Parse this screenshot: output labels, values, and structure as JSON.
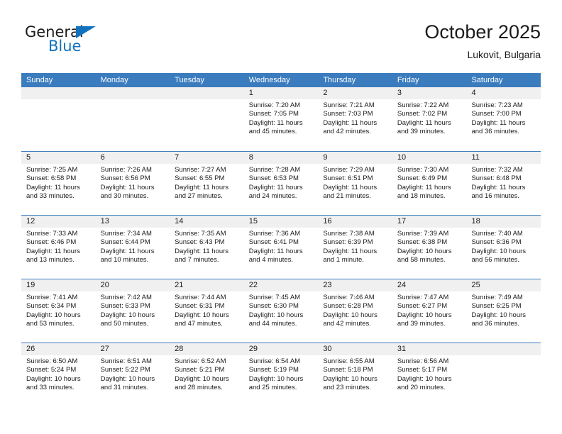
{
  "brand": {
    "name_top": "General",
    "name_bottom": "Blue",
    "accent_color": "#1272bd"
  },
  "header": {
    "title": "October 2025",
    "subtitle": "Lukovit, Bulgaria"
  },
  "theme": {
    "header_blue": "#3b7cbe",
    "day_band_gray": "#f0f0f0",
    "text": "#1b1b1b"
  },
  "weekdays": [
    "Sunday",
    "Monday",
    "Tuesday",
    "Wednesday",
    "Thursday",
    "Friday",
    "Saturday"
  ],
  "weeks": [
    [
      {
        "day": "",
        "sunrise": "",
        "sunset": "",
        "daylight": "",
        "daylight2": "",
        "empty": true
      },
      {
        "day": "",
        "sunrise": "",
        "sunset": "",
        "daylight": "",
        "daylight2": "",
        "empty": true
      },
      {
        "day": "",
        "sunrise": "",
        "sunset": "",
        "daylight": "",
        "daylight2": "",
        "empty": true
      },
      {
        "day": "1",
        "sunrise": "Sunrise: 7:20 AM",
        "sunset": "Sunset: 7:05 PM",
        "daylight": "Daylight: 11 hours",
        "daylight2": "and 45 minutes.",
        "empty": false
      },
      {
        "day": "2",
        "sunrise": "Sunrise: 7:21 AM",
        "sunset": "Sunset: 7:03 PM",
        "daylight": "Daylight: 11 hours",
        "daylight2": "and 42 minutes.",
        "empty": false
      },
      {
        "day": "3",
        "sunrise": "Sunrise: 7:22 AM",
        "sunset": "Sunset: 7:02 PM",
        "daylight": "Daylight: 11 hours",
        "daylight2": "and 39 minutes.",
        "empty": false
      },
      {
        "day": "4",
        "sunrise": "Sunrise: 7:23 AM",
        "sunset": "Sunset: 7:00 PM",
        "daylight": "Daylight: 11 hours",
        "daylight2": "and 36 minutes.",
        "empty": false
      }
    ],
    [
      {
        "day": "5",
        "sunrise": "Sunrise: 7:25 AM",
        "sunset": "Sunset: 6:58 PM",
        "daylight": "Daylight: 11 hours",
        "daylight2": "and 33 minutes.",
        "empty": false
      },
      {
        "day": "6",
        "sunrise": "Sunrise: 7:26 AM",
        "sunset": "Sunset: 6:56 PM",
        "daylight": "Daylight: 11 hours",
        "daylight2": "and 30 minutes.",
        "empty": false
      },
      {
        "day": "7",
        "sunrise": "Sunrise: 7:27 AM",
        "sunset": "Sunset: 6:55 PM",
        "daylight": "Daylight: 11 hours",
        "daylight2": "and 27 minutes.",
        "empty": false
      },
      {
        "day": "8",
        "sunrise": "Sunrise: 7:28 AM",
        "sunset": "Sunset: 6:53 PM",
        "daylight": "Daylight: 11 hours",
        "daylight2": "and 24 minutes.",
        "empty": false
      },
      {
        "day": "9",
        "sunrise": "Sunrise: 7:29 AM",
        "sunset": "Sunset: 6:51 PM",
        "daylight": "Daylight: 11 hours",
        "daylight2": "and 21 minutes.",
        "empty": false
      },
      {
        "day": "10",
        "sunrise": "Sunrise: 7:30 AM",
        "sunset": "Sunset: 6:49 PM",
        "daylight": "Daylight: 11 hours",
        "daylight2": "and 18 minutes.",
        "empty": false
      },
      {
        "day": "11",
        "sunrise": "Sunrise: 7:32 AM",
        "sunset": "Sunset: 6:48 PM",
        "daylight": "Daylight: 11 hours",
        "daylight2": "and 16 minutes.",
        "empty": false
      }
    ],
    [
      {
        "day": "12",
        "sunrise": "Sunrise: 7:33 AM",
        "sunset": "Sunset: 6:46 PM",
        "daylight": "Daylight: 11 hours",
        "daylight2": "and 13 minutes.",
        "empty": false
      },
      {
        "day": "13",
        "sunrise": "Sunrise: 7:34 AM",
        "sunset": "Sunset: 6:44 PM",
        "daylight": "Daylight: 11 hours",
        "daylight2": "and 10 minutes.",
        "empty": false
      },
      {
        "day": "14",
        "sunrise": "Sunrise: 7:35 AM",
        "sunset": "Sunset: 6:43 PM",
        "daylight": "Daylight: 11 hours",
        "daylight2": "and 7 minutes.",
        "empty": false
      },
      {
        "day": "15",
        "sunrise": "Sunrise: 7:36 AM",
        "sunset": "Sunset: 6:41 PM",
        "daylight": "Daylight: 11 hours",
        "daylight2": "and 4 minutes.",
        "empty": false
      },
      {
        "day": "16",
        "sunrise": "Sunrise: 7:38 AM",
        "sunset": "Sunset: 6:39 PM",
        "daylight": "Daylight: 11 hours",
        "daylight2": "and 1 minute.",
        "empty": false
      },
      {
        "day": "17",
        "sunrise": "Sunrise: 7:39 AM",
        "sunset": "Sunset: 6:38 PM",
        "daylight": "Daylight: 10 hours",
        "daylight2": "and 58 minutes.",
        "empty": false
      },
      {
        "day": "18",
        "sunrise": "Sunrise: 7:40 AM",
        "sunset": "Sunset: 6:36 PM",
        "daylight": "Daylight: 10 hours",
        "daylight2": "and 56 minutes.",
        "empty": false
      }
    ],
    [
      {
        "day": "19",
        "sunrise": "Sunrise: 7:41 AM",
        "sunset": "Sunset: 6:34 PM",
        "daylight": "Daylight: 10 hours",
        "daylight2": "and 53 minutes.",
        "empty": false
      },
      {
        "day": "20",
        "sunrise": "Sunrise: 7:42 AM",
        "sunset": "Sunset: 6:33 PM",
        "daylight": "Daylight: 10 hours",
        "daylight2": "and 50 minutes.",
        "empty": false
      },
      {
        "day": "21",
        "sunrise": "Sunrise: 7:44 AM",
        "sunset": "Sunset: 6:31 PM",
        "daylight": "Daylight: 10 hours",
        "daylight2": "and 47 minutes.",
        "empty": false
      },
      {
        "day": "22",
        "sunrise": "Sunrise: 7:45 AM",
        "sunset": "Sunset: 6:30 PM",
        "daylight": "Daylight: 10 hours",
        "daylight2": "and 44 minutes.",
        "empty": false
      },
      {
        "day": "23",
        "sunrise": "Sunrise: 7:46 AM",
        "sunset": "Sunset: 6:28 PM",
        "daylight": "Daylight: 10 hours",
        "daylight2": "and 42 minutes.",
        "empty": false
      },
      {
        "day": "24",
        "sunrise": "Sunrise: 7:47 AM",
        "sunset": "Sunset: 6:27 PM",
        "daylight": "Daylight: 10 hours",
        "daylight2": "and 39 minutes.",
        "empty": false
      },
      {
        "day": "25",
        "sunrise": "Sunrise: 7:49 AM",
        "sunset": "Sunset: 6:25 PM",
        "daylight": "Daylight: 10 hours",
        "daylight2": "and 36 minutes.",
        "empty": false
      }
    ],
    [
      {
        "day": "26",
        "sunrise": "Sunrise: 6:50 AM",
        "sunset": "Sunset: 5:24 PM",
        "daylight": "Daylight: 10 hours",
        "daylight2": "and 33 minutes.",
        "empty": false
      },
      {
        "day": "27",
        "sunrise": "Sunrise: 6:51 AM",
        "sunset": "Sunset: 5:22 PM",
        "daylight": "Daylight: 10 hours",
        "daylight2": "and 31 minutes.",
        "empty": false
      },
      {
        "day": "28",
        "sunrise": "Sunrise: 6:52 AM",
        "sunset": "Sunset: 5:21 PM",
        "daylight": "Daylight: 10 hours",
        "daylight2": "and 28 minutes.",
        "empty": false
      },
      {
        "day": "29",
        "sunrise": "Sunrise: 6:54 AM",
        "sunset": "Sunset: 5:19 PM",
        "daylight": "Daylight: 10 hours",
        "daylight2": "and 25 minutes.",
        "empty": false
      },
      {
        "day": "30",
        "sunrise": "Sunrise: 6:55 AM",
        "sunset": "Sunset: 5:18 PM",
        "daylight": "Daylight: 10 hours",
        "daylight2": "and 23 minutes.",
        "empty": false
      },
      {
        "day": "31",
        "sunrise": "Sunrise: 6:56 AM",
        "sunset": "Sunset: 5:17 PM",
        "daylight": "Daylight: 10 hours",
        "daylight2": "and 20 minutes.",
        "empty": false
      },
      {
        "day": "",
        "sunrise": "",
        "sunset": "",
        "daylight": "",
        "daylight2": "",
        "empty": true
      }
    ]
  ]
}
